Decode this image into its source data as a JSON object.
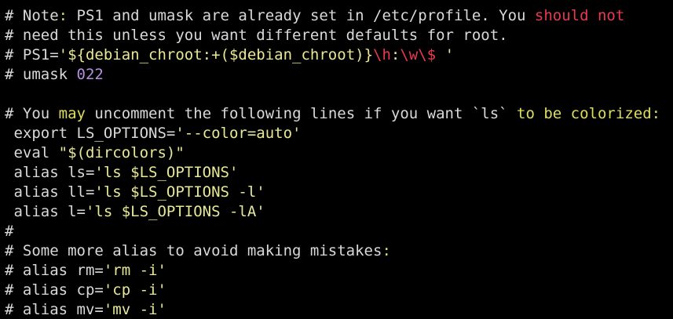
{
  "colors": {
    "background": "#000000",
    "normal": "#d9d9d9",
    "string": "#e8e896",
    "keyword": "#e8e860",
    "red": "#e8394d",
    "purple": "#b48ee0",
    "yellow": "#dede5a"
  },
  "lines": [
    [
      {
        "t": "# Note",
        "c": "normal"
      },
      {
        "t": ":",
        "c": "yellow"
      },
      {
        "t": " PS1 and umask are already set in /etc/profile. You ",
        "c": "normal"
      },
      {
        "t": "should not",
        "c": "red"
      }
    ],
    [
      {
        "t": "# need this unless you want different defaults for root.",
        "c": "normal"
      }
    ],
    [
      {
        "t": "# PS1=",
        "c": "normal"
      },
      {
        "t": "'${debian_chroot:+($debian_chroot)}",
        "c": "string"
      },
      {
        "t": "\\h",
        "c": "red"
      },
      {
        "t": ":",
        "c": "string"
      },
      {
        "t": "\\w\\$",
        "c": "red"
      },
      {
        "t": " '",
        "c": "string"
      }
    ],
    [
      {
        "t": "# umask ",
        "c": "normal"
      },
      {
        "t": "022",
        "c": "purple"
      }
    ],
    [],
    [
      {
        "t": "# You ",
        "c": "normal"
      },
      {
        "t": "may",
        "c": "yellow"
      },
      {
        "t": " uncomment the following lines if you want `ls` ",
        "c": "normal"
      },
      {
        "t": "to be colorized:",
        "c": "yellow"
      }
    ],
    [
      {
        "t": " export LS_OPTIONS=",
        "c": "normal"
      },
      {
        "t": "'--color=auto'",
        "c": "string"
      }
    ],
    [
      {
        "t": " eval ",
        "c": "normal"
      },
      {
        "t": "\"$(dircolors)\"",
        "c": "string"
      }
    ],
    [
      {
        "t": " alias ls=",
        "c": "normal"
      },
      {
        "t": "'ls $LS_OPTIONS'",
        "c": "string"
      }
    ],
    [
      {
        "t": " alias ll=",
        "c": "normal"
      },
      {
        "t": "'ls $LS_OPTIONS -l'",
        "c": "string"
      }
    ],
    [
      {
        "t": " alias l=",
        "c": "normal"
      },
      {
        "t": "'ls $LS_OPTIONS -lA'",
        "c": "string"
      }
    ],
    [
      {
        "t": "#",
        "c": "normal"
      }
    ],
    [
      {
        "t": "# Some more alias to avoid making mistakes",
        "c": "normal"
      },
      {
        "t": ":",
        "c": "yellow"
      }
    ],
    [
      {
        "t": "# alias rm=",
        "c": "normal"
      },
      {
        "t": "'rm -i'",
        "c": "string"
      }
    ],
    [
      {
        "t": "# alias cp=",
        "c": "normal"
      },
      {
        "t": "'cp -i'",
        "c": "string"
      }
    ],
    [
      {
        "t": "# alias mv=",
        "c": "normal"
      },
      {
        "t": "'mv -i'",
        "c": "string"
      }
    ]
  ]
}
